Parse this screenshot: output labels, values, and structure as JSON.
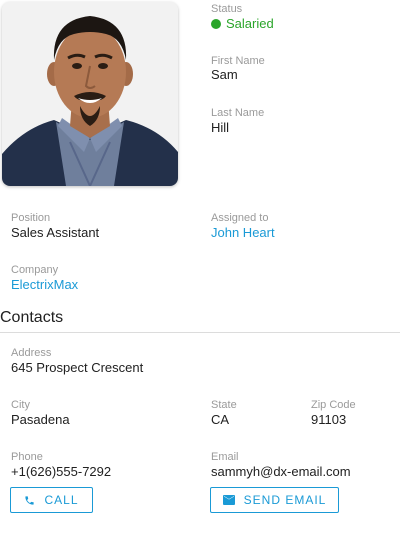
{
  "profile": {
    "status_label": "Status",
    "status_value": "Salaried",
    "first_name_label": "First Name",
    "first_name": "Sam",
    "last_name_label": "Last Name",
    "last_name": "Hill"
  },
  "details": {
    "position_label": "Position",
    "position": "Sales Assistant",
    "assigned_label": "Assigned to",
    "assigned_to": "John Heart",
    "company_label": "Company",
    "company": "ElectrixMax"
  },
  "contacts": {
    "title": "Contacts",
    "address_label": "Address",
    "address": "645 Prospect Crescent",
    "city_label": "City",
    "city": "Pasadena",
    "state_label": "State",
    "state": "CA",
    "zip_label": "Zip Code",
    "zip": "91103",
    "phone_label": "Phone",
    "phone": "+1(626)555-7292",
    "email_label": "Email",
    "email": "sammyh@dx-email.com",
    "call_button": "CALL",
    "email_button": "SEND EMAIL"
  },
  "colors": {
    "accent": "#1a9ad6",
    "status_green": "#2aa52a",
    "label_gray": "#9a9a9a"
  },
  "icons": {
    "call": "phone-icon",
    "email": "envelope-icon"
  }
}
